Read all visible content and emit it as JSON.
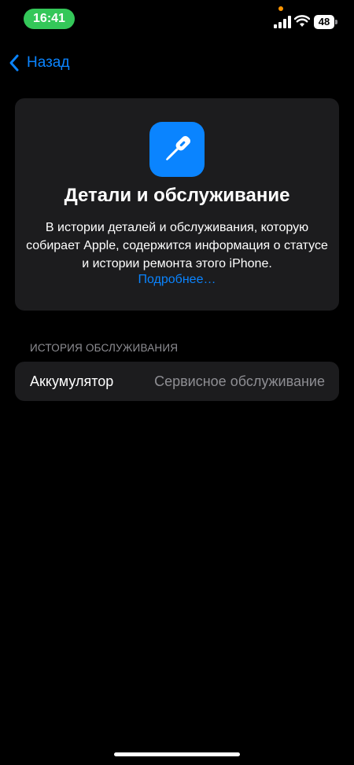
{
  "status_bar": {
    "time": "16:41",
    "battery_level": "48",
    "time_pill_color": "#34c759",
    "privacy_dot_color": "#ff9500",
    "icons": [
      "signal-icon",
      "wifi-icon",
      "battery-icon"
    ]
  },
  "nav": {
    "back_label": "Назад",
    "back_icon": "chevron-left-icon",
    "accent_color": "#0a84ff"
  },
  "info_card": {
    "icon": "screwdriver-icon",
    "icon_background": "#0a84ff",
    "title": "Детали и обслуживание",
    "description": "В истории деталей и обслуживания, которую собирает Apple, содержится информация о статусе и истории ремонта этого iPhone.",
    "link": "Подробнее…"
  },
  "service_history": {
    "header": "ИСТОРИЯ ОБСЛУЖИВАНИЯ",
    "rows": [
      {
        "label": "Аккумулятор",
        "value": "Сервисное обслуживание"
      }
    ]
  }
}
